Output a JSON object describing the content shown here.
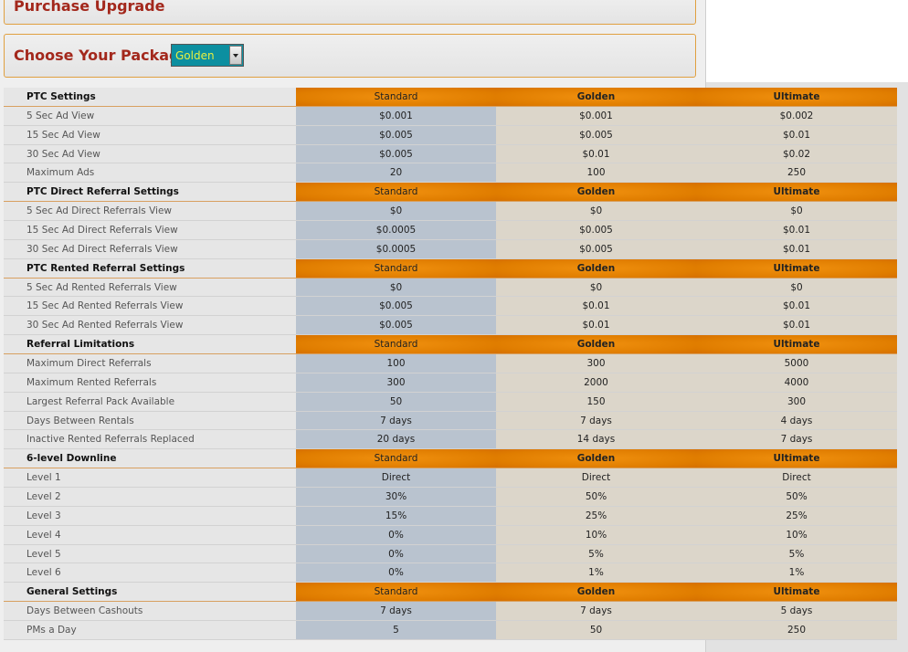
{
  "page": {
    "title": "Purchase Upgrade",
    "choose_label": "Choose Your Package:",
    "package_select": {
      "selected": "Golden"
    }
  },
  "colors": {
    "title_text": "#a3281c",
    "panel_border": "#e0a040",
    "header_orange": "#e07d00",
    "standard_column": "#b9c3cf",
    "other_columns": "#dcd6ca",
    "select_bg": "#0c8fa0",
    "select_text": "#e8f040"
  },
  "sections": [
    {
      "title": "PTC Settings",
      "columns": [
        "Standard",
        "Golden",
        "Ultimate"
      ],
      "rows": [
        {
          "label": "5 Sec Ad View",
          "values": [
            "$0.001",
            "$0.001",
            "$0.002"
          ]
        },
        {
          "label": "15 Sec Ad View",
          "values": [
            "$0.005",
            "$0.005",
            "$0.01"
          ]
        },
        {
          "label": "30 Sec Ad View",
          "values": [
            "$0.005",
            "$0.01",
            "$0.02"
          ]
        },
        {
          "label": "Maximum Ads",
          "values": [
            "20",
            "100",
            "250"
          ]
        }
      ]
    },
    {
      "title": "PTC Direct Referral Settings",
      "columns": [
        "Standard",
        "Golden",
        "Ultimate"
      ],
      "rows": [
        {
          "label": "5 Sec Ad Direct Referrals View",
          "values": [
            "$0",
            "$0",
            "$0"
          ]
        },
        {
          "label": "15 Sec Ad Direct Referrals View",
          "values": [
            "$0.0005",
            "$0.005",
            "$0.01"
          ]
        },
        {
          "label": "30 Sec Ad Direct Referrals View",
          "values": [
            "$0.0005",
            "$0.005",
            "$0.01"
          ]
        }
      ]
    },
    {
      "title": "PTC Rented Referral Settings",
      "columns": [
        "Standard",
        "Golden",
        "Ultimate"
      ],
      "rows": [
        {
          "label": "5 Sec Ad Rented Referrals View",
          "values": [
            "$0",
            "$0",
            "$0"
          ]
        },
        {
          "label": "15 Sec Ad Rented Referrals View",
          "values": [
            "$0.005",
            "$0.01",
            "$0.01"
          ]
        },
        {
          "label": "30 Sec Ad Rented Referrals View",
          "values": [
            "$0.005",
            "$0.01",
            "$0.01"
          ]
        }
      ]
    },
    {
      "title": "Referral Limitations",
      "columns": [
        "Standard",
        "Golden",
        "Ultimate"
      ],
      "rows": [
        {
          "label": "Maximum Direct Referrals",
          "values": [
            "100",
            "300",
            "5000"
          ]
        },
        {
          "label": "Maximum Rented Referrals",
          "values": [
            "300",
            "2000",
            "4000"
          ]
        },
        {
          "label": "Largest Referral Pack Available",
          "values": [
            "50",
            "150",
            "300"
          ]
        },
        {
          "label": "Days Between Rentals",
          "values": [
            "7 days",
            "7 days",
            "4 days"
          ]
        },
        {
          "label": "Inactive Rented Referrals Replaced",
          "values": [
            "20 days",
            "14 days",
            "7 days"
          ]
        }
      ]
    },
    {
      "title": "6-level Downline",
      "columns": [
        "Standard",
        "Golden",
        "Ultimate"
      ],
      "rows": [
        {
          "label": "Level 1",
          "values": [
            "Direct",
            "Direct",
            "Direct"
          ]
        },
        {
          "label": "Level 2",
          "values": [
            "30%",
            "50%",
            "50%"
          ]
        },
        {
          "label": "Level 3",
          "values": [
            "15%",
            "25%",
            "25%"
          ]
        },
        {
          "label": "Level 4",
          "values": [
            "0%",
            "10%",
            "10%"
          ]
        },
        {
          "label": "Level 5",
          "values": [
            "0%",
            "5%",
            "5%"
          ]
        },
        {
          "label": "Level 6",
          "values": [
            "0%",
            "1%",
            "1%"
          ]
        }
      ]
    },
    {
      "title": "General Settings",
      "columns": [
        "Standard",
        "Golden",
        "Ultimate"
      ],
      "rows": [
        {
          "label": "Days Between Cashouts",
          "values": [
            "7 days",
            "7 days",
            "5 days"
          ]
        },
        {
          "label": "PMs a Day",
          "values": [
            "5",
            "50",
            "250"
          ]
        }
      ]
    }
  ]
}
